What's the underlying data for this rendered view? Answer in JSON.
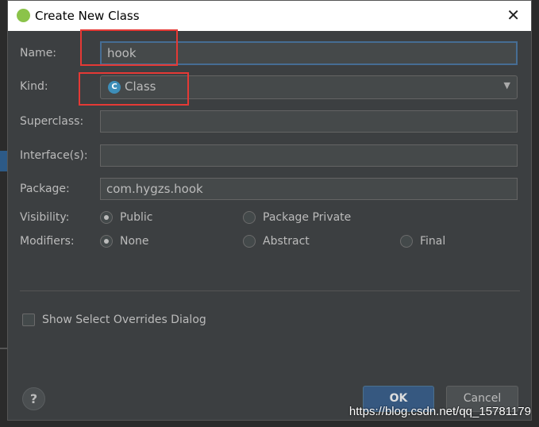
{
  "title": "Create New Class",
  "fields": {
    "name": {
      "label": "Name:",
      "value": "hook"
    },
    "kind": {
      "label": "Kind:",
      "value": "Class",
      "icon": "class-c-icon"
    },
    "superclass": {
      "label": "Superclass:",
      "value": ""
    },
    "interfaces": {
      "label": "Interface(s):",
      "value": ""
    },
    "package": {
      "label": "Package:",
      "value": "com.hygzs.hook"
    }
  },
  "visibility": {
    "label": "Visibility:",
    "options": [
      {
        "label": "Public",
        "selected": true
      },
      {
        "label": "Package Private",
        "selected": false
      }
    ]
  },
  "modifiers": {
    "label": "Modifiers:",
    "options": [
      {
        "label": "None",
        "selected": true
      },
      {
        "label": "Abstract",
        "selected": false
      },
      {
        "label": "Final",
        "selected": false
      }
    ]
  },
  "overrides": {
    "label": "Show Select Overrides Dialog",
    "checked": false
  },
  "buttons": {
    "ok": "OK",
    "cancel": "Cancel",
    "help": "?"
  },
  "watermark": "https://blog.csdn.net/qq_15781179",
  "colors": {
    "accent": "#365880",
    "highlight": "#e53935"
  }
}
